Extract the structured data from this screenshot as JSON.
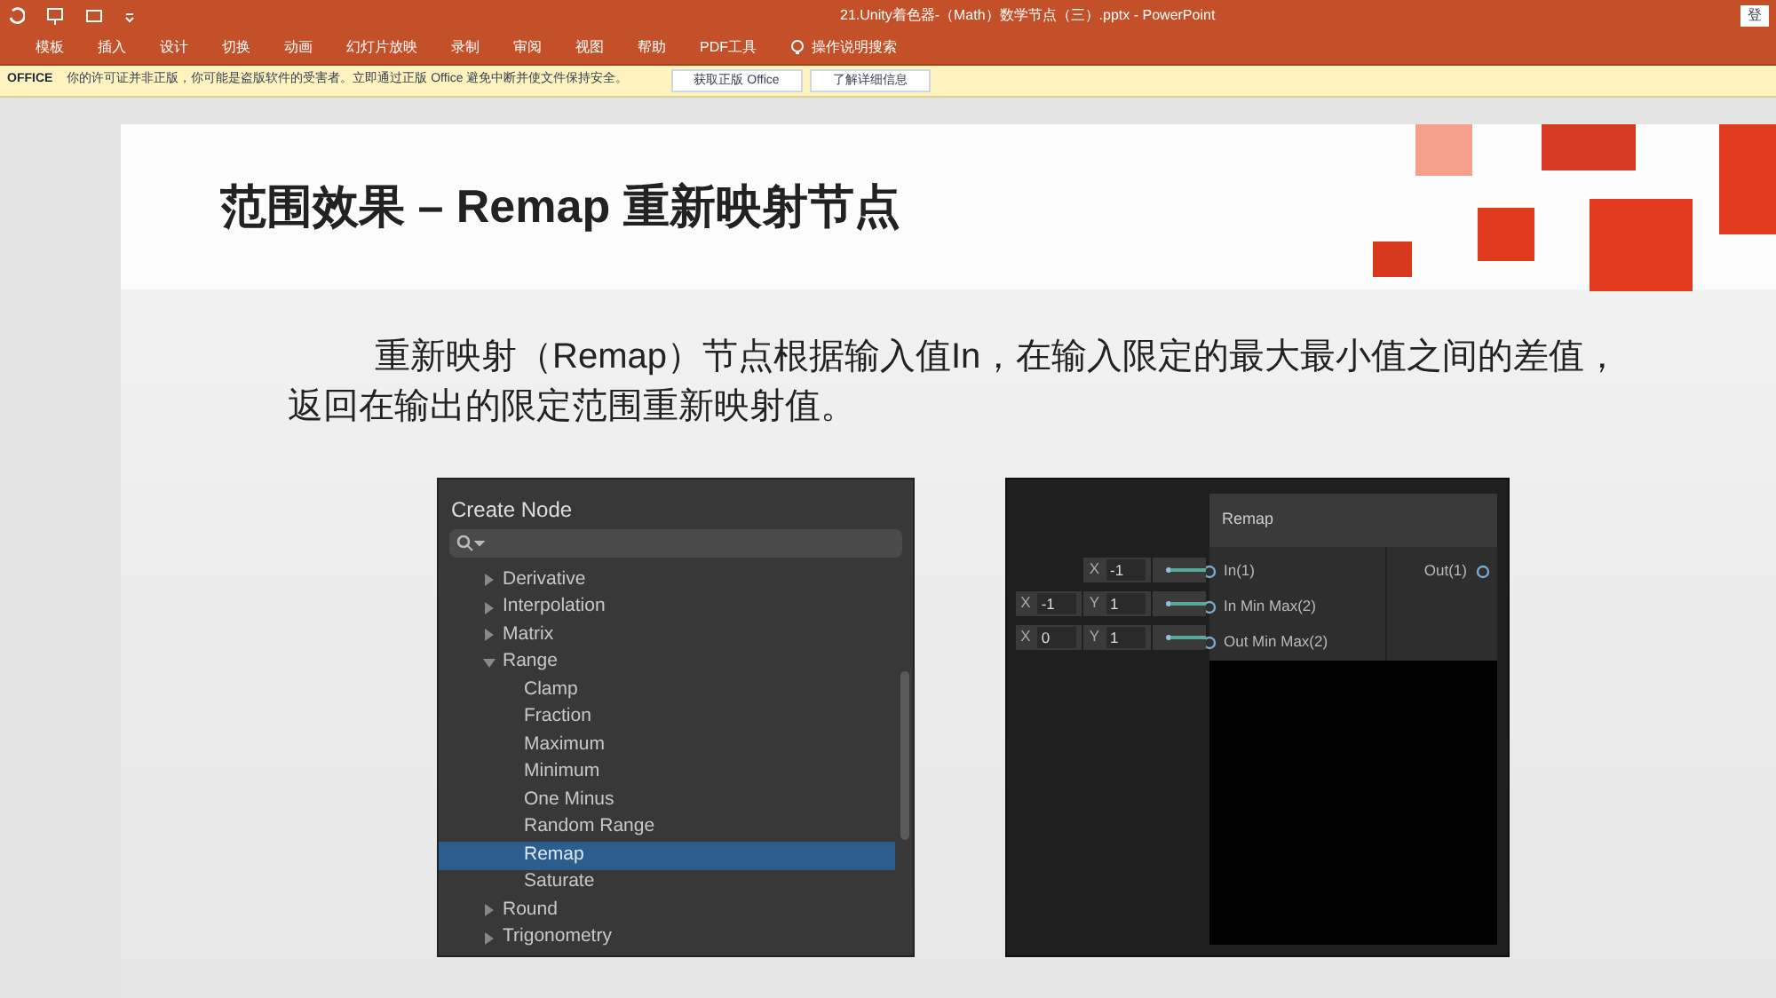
{
  "window": {
    "title": "21.Unity着色器-（Math）数学节点（三）.pptx  -  PowerPoint",
    "account": "登"
  },
  "ribbon_tabs": [
    "模板",
    "插入",
    "设计",
    "切换",
    "动画",
    "幻灯片放映",
    "录制",
    "审阅",
    "视图",
    "帮助",
    "PDF工具"
  ],
  "tell_me": "操作说明搜索",
  "notice": {
    "label": "OFFICE",
    "message": "你的许可证并非正版，你可能是盗版软件的受害者。立即通过正版 Office 避免中断并使文件保持安全。",
    "buttons": [
      "获取正版 Office",
      "了解详细信息"
    ]
  },
  "slide": {
    "title": "范围效果 – Remap 重新映射节点",
    "body": "重新映射（Remap）节点根据输入值In，在输入限定的最大最小值之间的差值，返回在输出的限定范围重新映射值。",
    "create_node": {
      "title": "Create Node",
      "tree": [
        {
          "label": "Derivative",
          "expanded": false
        },
        {
          "label": "Interpolation",
          "expanded": false
        },
        {
          "label": "Matrix",
          "expanded": false
        },
        {
          "label": "Range",
          "expanded": true,
          "children": [
            {
              "label": "Clamp",
              "selected": false
            },
            {
              "label": "Fraction",
              "selected": false
            },
            {
              "label": "Maximum",
              "selected": false
            },
            {
              "label": "Minimum",
              "selected": false
            },
            {
              "label": "One Minus",
              "selected": false
            },
            {
              "label": "Random Range",
              "selected": false
            },
            {
              "label": "Remap",
              "selected": true
            },
            {
              "label": "Saturate",
              "selected": false
            }
          ]
        },
        {
          "label": "Round",
          "expanded": false
        },
        {
          "label": "Trigonometry",
          "expanded": false
        }
      ]
    },
    "node": {
      "title": "Remap",
      "inputs": [
        {
          "label": "In(1)",
          "fields": [
            {
              "axis": "X",
              "value": "-1"
            }
          ]
        },
        {
          "label": "In Min Max(2)",
          "fields": [
            {
              "axis": "X",
              "value": "-1"
            },
            {
              "axis": "Y",
              "value": "1"
            }
          ]
        },
        {
          "label": "Out Min Max(2)",
          "fields": [
            {
              "axis": "X",
              "value": "0"
            },
            {
              "axis": "Y",
              "value": "1"
            }
          ]
        }
      ],
      "outputs": [
        "Out(1)"
      ]
    }
  }
}
